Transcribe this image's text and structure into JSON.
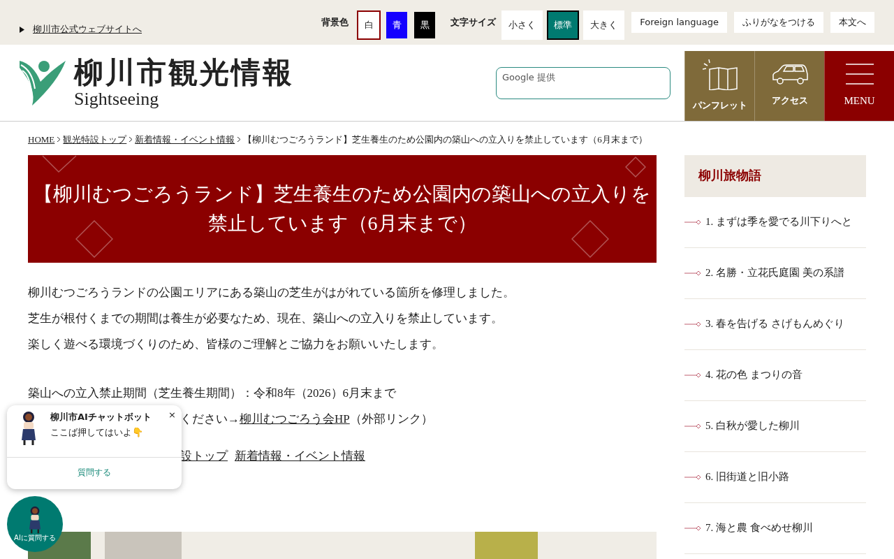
{
  "top_bar": {
    "site_link": "柳川市公式ウェブサイトへ",
    "bg_color": {
      "label": "背景色",
      "options": [
        {
          "label": "白",
          "selected": true,
          "color": "#ffffff"
        },
        {
          "label": "青",
          "selected": false,
          "color": "#1400ff"
        },
        {
          "label": "黒",
          "selected": false,
          "color": "#000000"
        }
      ]
    },
    "text_size": {
      "label": "文字サイズ",
      "options": [
        {
          "label": "小さく",
          "selected": false
        },
        {
          "label": "標準",
          "selected": true
        },
        {
          "label": "大きく",
          "selected": false
        }
      ]
    },
    "links": [
      "Foreign language",
      "ふりがなをつける",
      "本文へ"
    ]
  },
  "header": {
    "title": "柳川市観光情報",
    "subtitle": "Sightseeing",
    "search": {
      "placeholder": "Google 提供"
    },
    "nav": [
      {
        "kind": "map",
        "label": "パンフレット"
      },
      {
        "kind": "car",
        "label": "アクセス"
      },
      {
        "kind": "menu",
        "label": "MENU"
      }
    ]
  },
  "breadcrumb": {
    "links": [
      "HOME",
      "観光特設トップ",
      "新着情報・イベント情報"
    ],
    "current": "【柳川むつごろうランド】芝生養生のため公園内の築山への立入りを禁止しています（6月末まで）"
  },
  "article": {
    "title": "【柳川むつごろうランド】芝生養生のため公園内の築山への立入りを禁止しています（6月末まで）",
    "paragraphs": [
      "柳川むつごろうランドの公園エリアにある築山の芝生がはがれている箇所を修理しました。",
      "芝生が根付くまでの期間は養生が必要なため、現在、築山への立入りを禁止しています。",
      "楽しく遊べる環境づくりのため、皆様のご理解とご協力をお願いいたします。"
    ],
    "period": "築山への立入禁止期間（芝生養生期間）：令和8年（2026）6月末まで",
    "more": {
      "text": "ください→",
      "link": "柳川むつごろう会HP",
      "note": "（外部リンク）"
    },
    "related_links": [
      "設トップ",
      "新着情報・イベント情報"
    ]
  },
  "sidebar": {
    "heading": "柳川旅物語",
    "items": [
      "1. まずは季を愛でる川下りへと",
      "2. 名勝・立花氏庭園 美の系譜",
      "3. 春を告げる さげもんめぐり",
      "4. 花の色 まつりの音",
      "5. 白秋が愛した柳川",
      "6. 旧街道と旧小路",
      "7. 海と農 食べめせ柳川"
    ]
  },
  "chatbot": {
    "title": "柳川市AIチャットボット",
    "message": "ここば押してはいよ👇",
    "close": "×",
    "ask_button": "質問する",
    "fab_label": "AIに質問する"
  }
}
